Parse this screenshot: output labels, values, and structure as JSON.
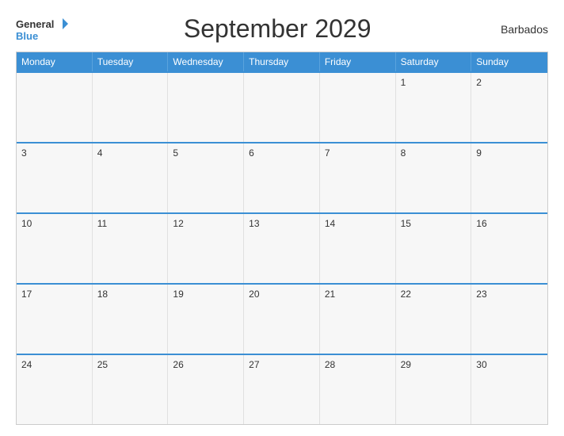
{
  "header": {
    "title": "September 2029",
    "country": "Barbados",
    "logo_general": "General",
    "logo_blue": "Blue"
  },
  "days_of_week": [
    "Monday",
    "Tuesday",
    "Wednesday",
    "Thursday",
    "Friday",
    "Saturday",
    "Sunday"
  ],
  "weeks": [
    [
      {
        "day": "",
        "empty": true
      },
      {
        "day": "",
        "empty": true
      },
      {
        "day": "",
        "empty": true
      },
      {
        "day": "",
        "empty": true
      },
      {
        "day": "",
        "empty": true
      },
      {
        "day": "1"
      },
      {
        "day": "2"
      }
    ],
    [
      {
        "day": "3"
      },
      {
        "day": "4"
      },
      {
        "day": "5"
      },
      {
        "day": "6"
      },
      {
        "day": "7"
      },
      {
        "day": "8"
      },
      {
        "day": "9"
      }
    ],
    [
      {
        "day": "10"
      },
      {
        "day": "11"
      },
      {
        "day": "12"
      },
      {
        "day": "13"
      },
      {
        "day": "14"
      },
      {
        "day": "15"
      },
      {
        "day": "16"
      }
    ],
    [
      {
        "day": "17"
      },
      {
        "day": "18"
      },
      {
        "day": "19"
      },
      {
        "day": "20"
      },
      {
        "day": "21"
      },
      {
        "day": "22"
      },
      {
        "day": "23"
      }
    ],
    [
      {
        "day": "24"
      },
      {
        "day": "25"
      },
      {
        "day": "26"
      },
      {
        "day": "27"
      },
      {
        "day": "28"
      },
      {
        "day": "29"
      },
      {
        "day": "30"
      }
    ]
  ]
}
